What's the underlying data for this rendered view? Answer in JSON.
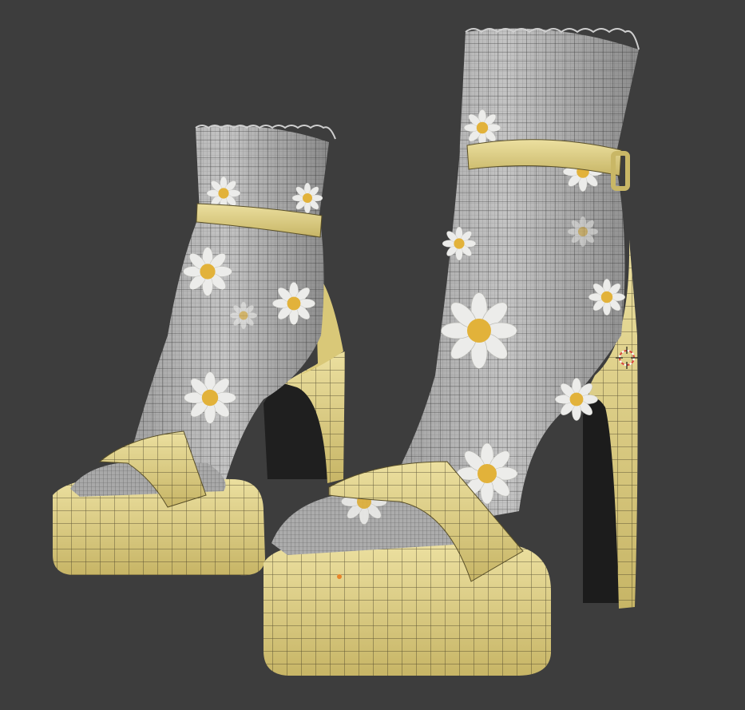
{
  "viewport": {
    "background_color": "#3d3d3d",
    "shading_mode": "solid-wireframe-overlay"
  },
  "colors": {
    "sandal": "#e6d587",
    "sandal_shade": "#c9b766",
    "sock": "#b9b9b9",
    "sock_shade": "#8e8e8e",
    "flower_petal": "#e9e9e6",
    "flower_center": "#e4b53a",
    "wire": "#2a2a2a",
    "heel_inner": "#1e1e1e",
    "cursor": "#d8463c"
  },
  "objects": [
    {
      "name": "sandal-left",
      "type": "platform-heel-sandal"
    },
    {
      "name": "sandal-right",
      "type": "platform-heel-sandal"
    },
    {
      "name": "sock-left",
      "type": "daisy-print-ruffle-sock"
    },
    {
      "name": "sock-right",
      "type": "daisy-print-ruffle-sock"
    }
  ],
  "cursor": {
    "icon": "3d-cursor-icon"
  }
}
